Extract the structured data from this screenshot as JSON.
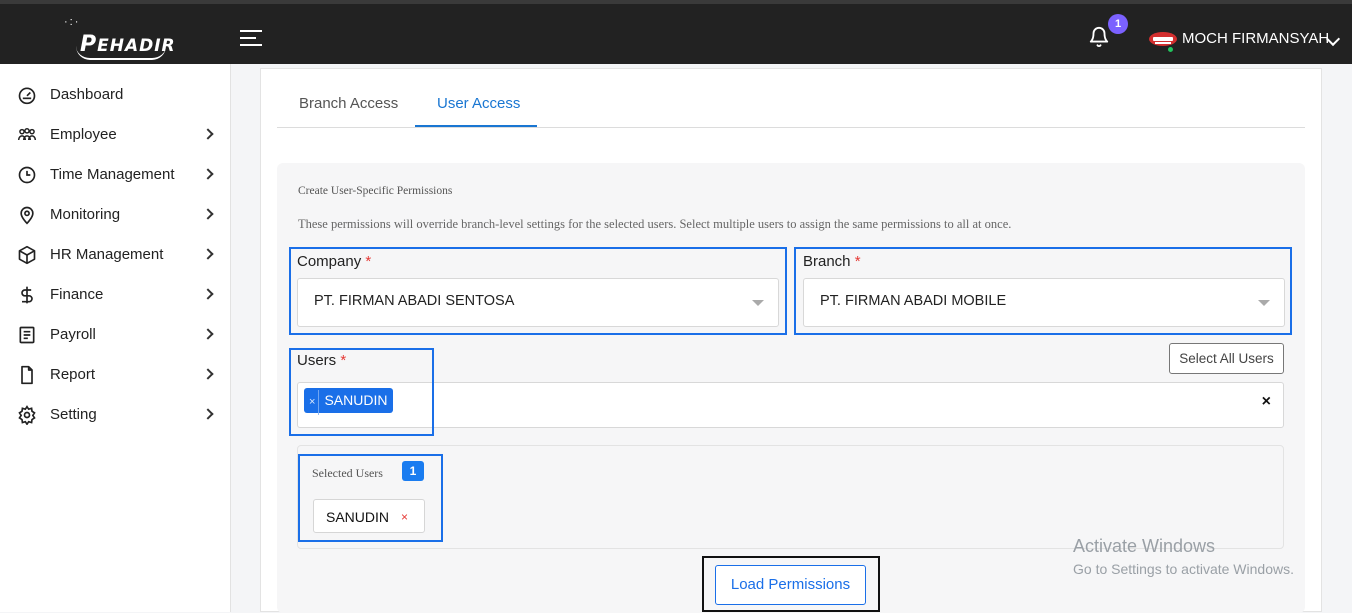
{
  "header": {
    "logo_text": "EHADIR",
    "notification_count": "1",
    "user_name": "MOCH FIRMANSYAH"
  },
  "sidebar": {
    "items": [
      {
        "label": "Dashboard",
        "icon": "dashboard-icon",
        "has_chevron": false
      },
      {
        "label": "Employee",
        "icon": "employees-icon",
        "has_chevron": true
      },
      {
        "label": "Time Management",
        "icon": "clock-icon",
        "has_chevron": true
      },
      {
        "label": "Monitoring",
        "icon": "map-pin-icon",
        "has_chevron": true
      },
      {
        "label": "HR Management",
        "icon": "box-icon",
        "has_chevron": true
      },
      {
        "label": "Finance",
        "icon": "dollar-icon",
        "has_chevron": true
      },
      {
        "label": "Payroll",
        "icon": "payroll-icon",
        "has_chevron": true
      },
      {
        "label": "Report",
        "icon": "document-icon",
        "has_chevron": true
      },
      {
        "label": "Setting",
        "icon": "gear-icon",
        "has_chevron": true
      }
    ]
  },
  "tabs": {
    "branch_access": "Branch Access",
    "user_access": "User Access",
    "active": "user_access"
  },
  "card": {
    "title": "Create User-Specific Permissions",
    "description": "These permissions will override branch-level settings for the selected users. Select multiple users to assign the same permissions to all at once."
  },
  "form": {
    "company_label": "Company",
    "company_value": "PT. FIRMAN ABADI SENTOSA",
    "branch_label": "Branch",
    "branch_value": "PT. FIRMAN ABADI MOBILE",
    "users_label": "Users",
    "required_mark": "*",
    "select_all_label": "Select All Users",
    "users_chip": "SANUDIN",
    "chip_remove": "×",
    "clear_all": "×"
  },
  "selected_users": {
    "title": "Selected Users",
    "count": "1",
    "items": [
      "SANUDIN"
    ],
    "remove": "×"
  },
  "actions": {
    "load_permissions": "Load Permissions"
  },
  "watermark": {
    "line1": "Activate Windows",
    "line2": "Go to Settings to activate Windows."
  },
  "colors": {
    "accent": "#1a6fe8",
    "topbar": "#222222",
    "required": "#e53935",
    "notif_badge": "#7b61ff",
    "online": "#22c55e"
  }
}
